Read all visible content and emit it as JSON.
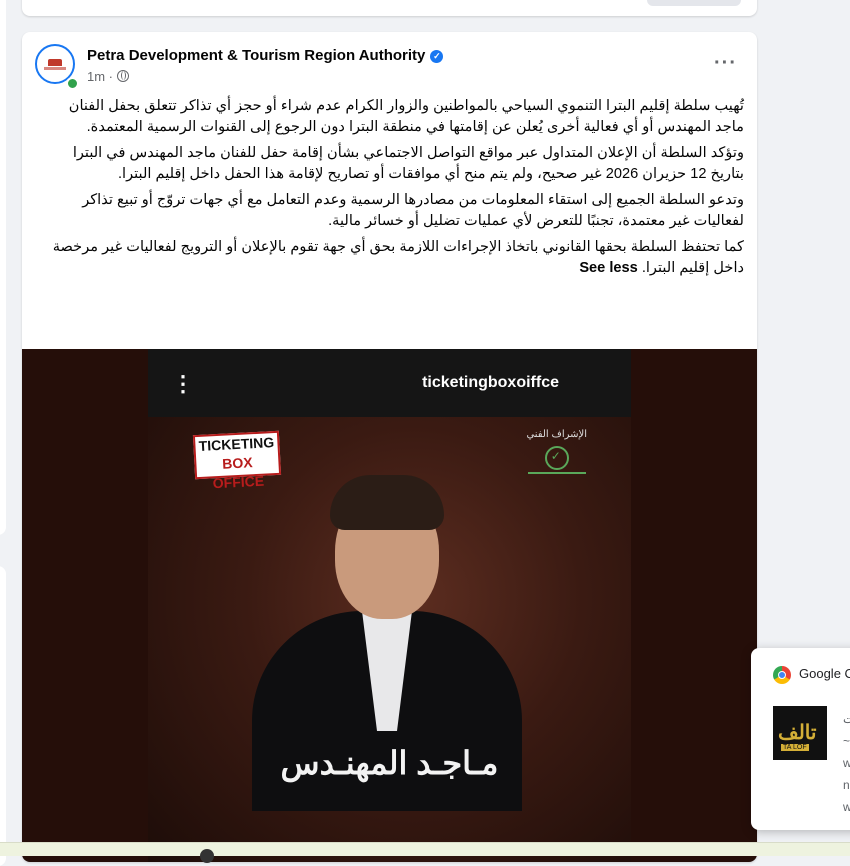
{
  "previous_post": {},
  "post": {
    "page_name": "Petra Development & Tourism Region Authority",
    "time": "1m · ",
    "more_label": "···",
    "paragraphs": [
      "تُهيب سلطة إقليم البترا التنموي السياحي بالمواطنين والزوار الكرام عدم شراء أو حجز أي تذاكر تتعلق بحفل الفنان ماجد المهندس أو أي فعالية أخرى يُعلن عن إقامتها في منطقة البترا دون الرجوع إلى القنوات الرسمية المعتمدة.",
      "وتؤكد السلطة أن الإعلان المتداول عبر مواقع التواصل الاجتماعي بشأن إقامة حفل للفنان ماجد المهندس في البترا بتاريخ 12 حزيران 2026 غير صحيح، ولم يتم منح أي موافقات أو تصاريح لإقامة هذا الحفل داخل إقليم البترا.",
      "وتدعو السلطة الجميع إلى استقاء المعلومات من مصادرها الرسمية وعدم التعامل مع أي جهات تروّج أو تبيع تذاكر لفعاليات غير معتمدة، تجنبًا للتعرض لأي عمليات تضليل أو خسائر مالية.",
      "كما تحتفظ السلطة بحقها القانوني باتخاذ الإجراءات اللازمة بحق أي جهة تقوم بالإعلان أو الترويج لفعاليات غير مرخصة داخل إقليم البترا."
    ],
    "see_less": "See less"
  },
  "poster": {
    "menu_icon": "⋮",
    "username": "ticketingboxoiffce",
    "stamp_line1": "TICKETING",
    "stamp_line2": "BOX OFFICE",
    "sponsor_label": "الإشراف الفني",
    "artist_name": "مـاجـد المهنـدس"
  },
  "notification": {
    "title": "Google C",
    "thumb_text": "تالف",
    "thumb_sub": "TA LOF",
    "text_lines": [
      "ت",
      "~",
      "w",
      "n",
      "w"
    ]
  },
  "colors": {
    "accent": "#1877f2",
    "background": "#f0f2f5",
    "photo_bg": "#250e09"
  }
}
